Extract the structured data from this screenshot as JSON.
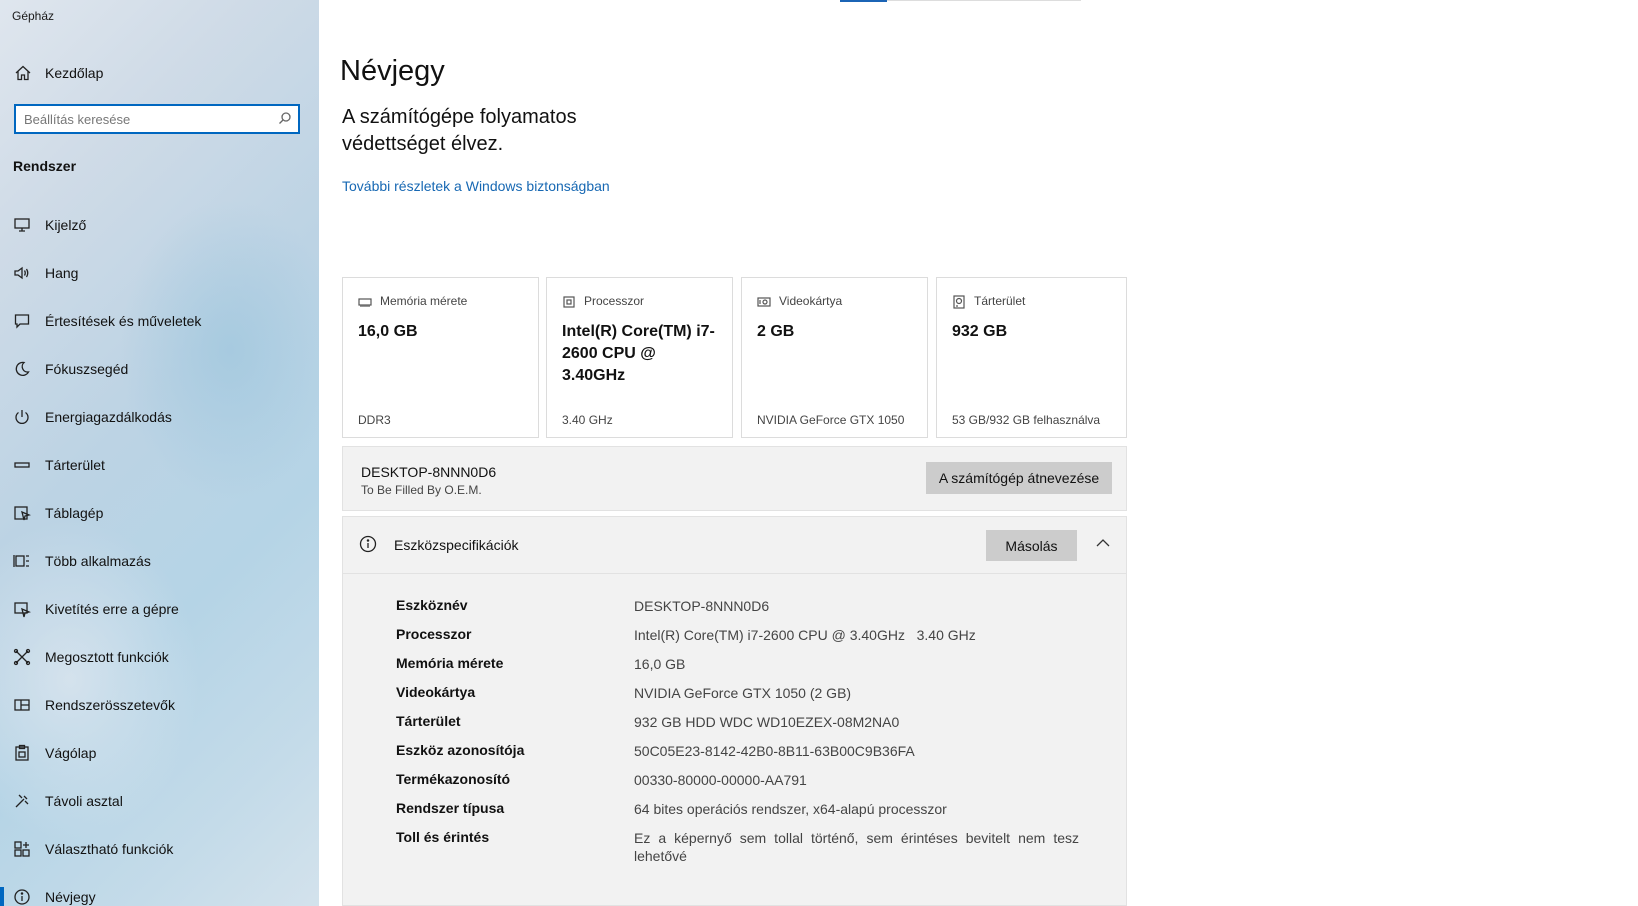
{
  "window": {
    "title": "Gépház"
  },
  "sidebar": {
    "home_label": "Kezdőlap",
    "search_placeholder": "Beállítás keresése",
    "section_title": "Rendszer",
    "items": [
      {
        "label": "Kijelző",
        "icon": "monitor-icon"
      },
      {
        "label": "Hang",
        "icon": "speaker-icon"
      },
      {
        "label": "Értesítések és műveletek",
        "icon": "notification-icon"
      },
      {
        "label": "Fókuszsegéd",
        "icon": "moon-icon"
      },
      {
        "label": "Energiagazdálkodás",
        "icon": "power-icon"
      },
      {
        "label": "Tárterület",
        "icon": "storage-icon"
      },
      {
        "label": "Táblagép",
        "icon": "tablet-icon"
      },
      {
        "label": "Több alkalmazás",
        "icon": "multitask-icon"
      },
      {
        "label": "Kivetítés erre a gépre",
        "icon": "project-icon"
      },
      {
        "label": "Megosztott funkciók",
        "icon": "share-icon"
      },
      {
        "label": "Rendszerösszetevők",
        "icon": "components-icon"
      },
      {
        "label": "Vágólap",
        "icon": "clipboard-icon"
      },
      {
        "label": "Távoli asztal",
        "icon": "remote-desktop-icon"
      },
      {
        "label": "Választható funkciók",
        "icon": "optional-features-icon"
      },
      {
        "label": "Névjegy",
        "icon": "info-icon"
      }
    ],
    "active_index": 14
  },
  "main": {
    "title": "Névjegy",
    "protection_text": "A számítógépe folyamatos védettséget élvez.",
    "security_link": "További részletek a Windows biztonságban",
    "cards": [
      {
        "label": "Memória mérete",
        "value": "16,0 GB",
        "detail": "DDR3",
        "icon": "memory-icon"
      },
      {
        "label": "Processzor",
        "value": "Intel(R) Core(TM) i7-2600 CPU @ 3.40GHz",
        "detail": "3.40 GHz",
        "icon": "cpu-icon"
      },
      {
        "label": "Videokártya",
        "value": "2 GB",
        "detail": "NVIDIA GeForce GTX 1050",
        "icon": "gpu-icon"
      },
      {
        "label": "Tárterület",
        "value": "932 GB",
        "detail": "53 GB/932 GB felhasználva",
        "icon": "drive-icon"
      }
    ],
    "pc": {
      "name": "DESKTOP-8NNN0D6",
      "model": "To Be Filled By O.E.M.",
      "rename_button": "A számítógép átnevezése"
    },
    "specs": {
      "title": "Eszközspecifikációk",
      "copy_button": "Másolás",
      "rows": [
        {
          "key": "Eszköznév",
          "value": "DESKTOP-8NNN0D6"
        },
        {
          "key": "Processzor",
          "value": "Intel(R) Core(TM) i7-2600 CPU @ 3.40GHz   3.40 GHz"
        },
        {
          "key": "Memória mérete",
          "value": "16,0 GB"
        },
        {
          "key": "Videokártya",
          "value": "NVIDIA GeForce GTX 1050 (2 GB)"
        },
        {
          "key": "Tárterület",
          "value": "932 GB HDD WDC WD10EZEX-08M2NA0"
        },
        {
          "key": "Eszköz azonosítója",
          "value": "50C05E23-8142-42B0-8B11-63B00C9B36FA"
        },
        {
          "key": "Termékazonosító",
          "value": "00330-80000-00000-AA791"
        },
        {
          "key": "Rendszer típusa",
          "value": "64 bites operációs rendszer, x64-alapú processzor"
        },
        {
          "key": "Toll és érintés",
          "value": "Ez a képernyő sem tollal történő, sem érintéses bevitelt nem tesz lehetővé"
        }
      ]
    }
  },
  "colors": {
    "accent": "#0067c0",
    "link": "#1768b3",
    "button": "#cccccc",
    "panel": "#f2f2f2"
  }
}
